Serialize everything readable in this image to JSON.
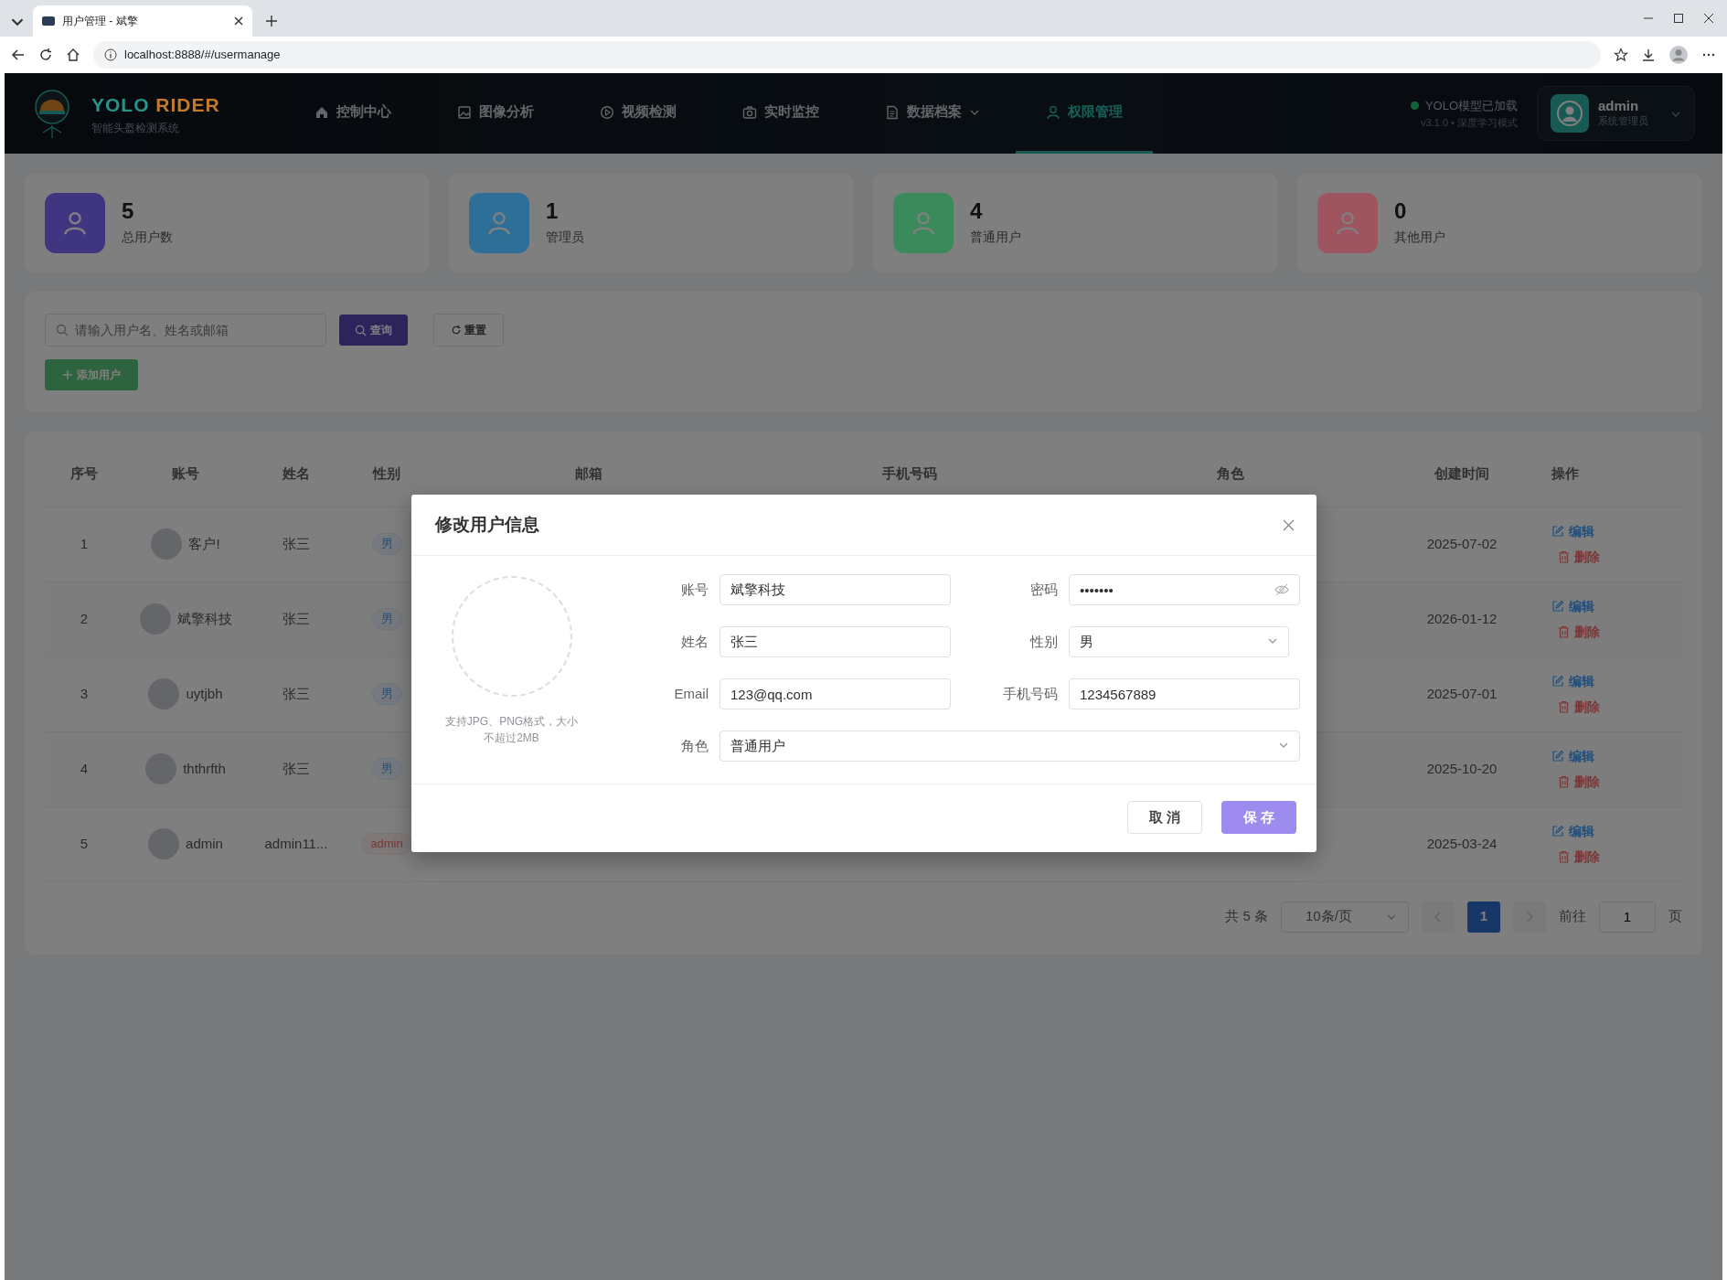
{
  "browser": {
    "tab_title": "用户管理 - 斌擎",
    "url": "localhost:8888/#/usermanage"
  },
  "header": {
    "title_parts": [
      {
        "text": "YOLO",
        "color": "#2a9388"
      },
      {
        "text": "RIDER",
        "color": "#c47a2a"
      }
    ],
    "subtitle": "智能头盔检测系统",
    "nav": [
      {
        "label": "控制中心",
        "selected": false,
        "dropdown": false
      },
      {
        "label": "图像分析",
        "selected": false,
        "dropdown": false
      },
      {
        "label": "视频检测",
        "selected": false,
        "dropdown": false
      },
      {
        "label": "实时监控",
        "selected": false,
        "dropdown": false
      },
      {
        "label": "数据档案",
        "selected": false,
        "dropdown": true
      },
      {
        "label": "权限管理",
        "selected": true,
        "dropdown": false
      }
    ],
    "status": "YOLO模型已加载",
    "version": "v3.1.0 • 深度学习模式",
    "user_name": "admin",
    "user_role": "系统管理员"
  },
  "stats": [
    {
      "value": "5",
      "label": "总用户数",
      "color": "#3f3580"
    },
    {
      "value": "1",
      "label": "管理员",
      "color": "#2e6f98"
    },
    {
      "value": "4",
      "label": "普通用户",
      "color": "#3a8a5b"
    },
    {
      "value": "0",
      "label": "其他用户",
      "color": "#9e5560"
    }
  ],
  "search": {
    "placeholder": "请输入用户名、姓名或邮箱",
    "query": "查询",
    "reset": "重置",
    "add": "添加用户"
  },
  "table": {
    "columns": [
      "序号",
      "账号",
      "姓名",
      "性别",
      "邮箱",
      "手机号码",
      "角色",
      "创建时间",
      "操作"
    ],
    "rows": [
      {
        "index": "1",
        "account": "客户!",
        "name": "张三",
        "tag": {
          "text": "男",
          "kind": "gender"
        },
        "created": "2025-07-02",
        "edit": "编辑",
        "delete": "删除"
      },
      {
        "index": "2",
        "account": "斌擎科技",
        "name": "张三",
        "tag": {
          "text": "男",
          "kind": "gender"
        },
        "created": "2026-01-12",
        "edit": "编辑",
        "delete": "删除"
      },
      {
        "index": "3",
        "account": "uytjbh",
        "name": "张三",
        "tag": {
          "text": "男",
          "kind": "gender"
        },
        "created": "2025-07-01",
        "edit": "编辑",
        "delete": "删除"
      },
      {
        "index": "4",
        "account": "ththrfth",
        "name": "张三",
        "tag": {
          "text": "男",
          "kind": "gender"
        },
        "created": "2025-10-20",
        "edit": "编辑",
        "delete": "删除"
      },
      {
        "index": "5",
        "account": "admin",
        "name": "admin11...",
        "tag": {
          "text": "admin",
          "kind": "admin"
        },
        "created": "2025-03-24",
        "edit": "编辑",
        "delete": "删除"
      }
    ]
  },
  "pagination": {
    "total": "共 5 条",
    "page_size": "10条/页",
    "pages": [
      {
        "label": "1",
        "selected": true
      }
    ],
    "goto": "前往",
    "goto_value": "1",
    "unit": "页"
  },
  "modal": {
    "title": "修改用户信息",
    "avatar_hint": "支持JPG、PNG格式，大小不超过2MB",
    "fields": [
      {
        "label": "账号",
        "value": "斌擎科技",
        "kind": "text"
      },
      {
        "label": "密码",
        "value": "•••••••",
        "kind": "password"
      },
      {
        "label": "姓名",
        "value": "张三",
        "kind": "text"
      },
      {
        "label": "性别",
        "value": "男",
        "kind": "select"
      },
      {
        "label": "Email",
        "value": "123@qq.com",
        "kind": "text"
      },
      {
        "label": "手机号码",
        "value": "1234567889",
        "kind": "text"
      },
      {
        "label": "角色",
        "value": "普通用户",
        "kind": "select-wide"
      }
    ],
    "cancel": "取 消",
    "save": "保 存"
  }
}
